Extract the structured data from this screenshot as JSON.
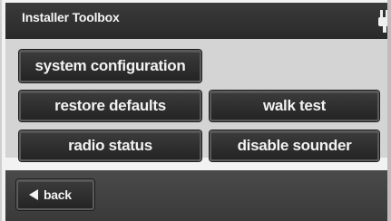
{
  "window": {
    "title": "Installer Toolbox"
  },
  "menu": {
    "buttons": [
      {
        "label": "system configuration"
      },
      {
        "label": "restore defaults"
      },
      {
        "label": "walk test"
      },
      {
        "label": "radio status"
      },
      {
        "label": "disable sounder"
      }
    ]
  },
  "footer": {
    "back_label": "back"
  },
  "icons": {
    "back": "left-triangle-arrow",
    "status": "plug-icon"
  },
  "colors": {
    "title_bar": "#2f2f2f",
    "content_bg": "#d4d4d4",
    "button_bg": "#2c2c2c",
    "button_text": "#f2f2f2"
  }
}
